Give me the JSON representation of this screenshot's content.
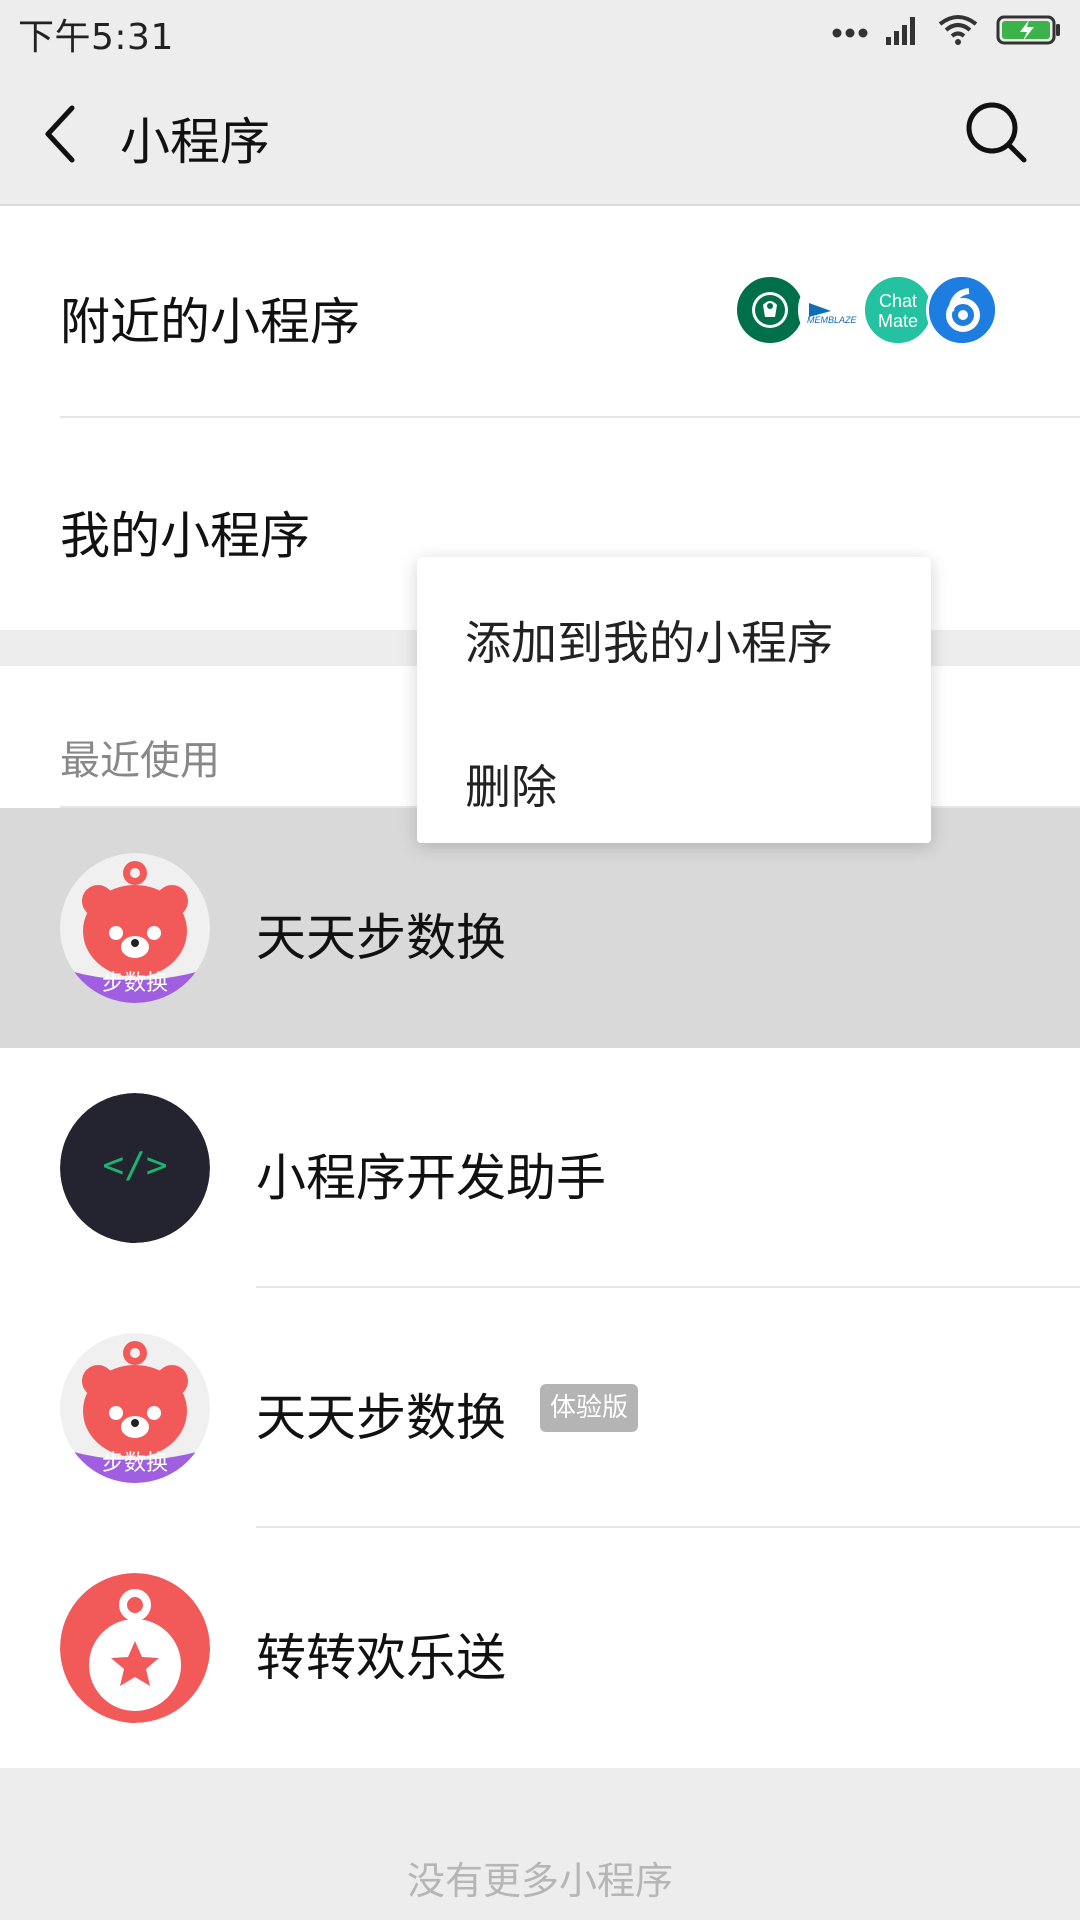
{
  "status_bar": {
    "time": "下午5:31",
    "icons": [
      "more-dots-icon",
      "signal-icon",
      "wifi-icon",
      "battery-charging-icon"
    ],
    "battery_color": "#3cb34a"
  },
  "header": {
    "title": "小程序",
    "back_icon": "chevron-left-icon",
    "search_icon": "search-icon"
  },
  "entries": {
    "nearby_label": "附近的小程序",
    "nearby_logos": [
      "starbucks-logo",
      "memblaze-logo",
      "chatmate-logo",
      "blue-six-logo"
    ],
    "nearby_logo_texts": {
      "memblaze": "MEMBLAZE",
      "chatmate": "Chat Mate"
    },
    "my_label": "我的小程序"
  },
  "recent": {
    "label": "最近使用",
    "items": [
      {
        "name": "天天步数换",
        "icon": "bear-step-icon",
        "icon_caption": "步数换",
        "badge": null,
        "pressed": true
      },
      {
        "name": "小程序开发助手",
        "icon": "code-icon",
        "icon_caption": "</>",
        "badge": null,
        "pressed": false
      },
      {
        "name": "天天步数换",
        "icon": "bear-step-icon",
        "icon_caption": "步数换",
        "badge": "体验版",
        "pressed": false
      },
      {
        "name": "转转欢乐送",
        "icon": "star-bag-icon",
        "icon_caption": "",
        "badge": null,
        "pressed": false
      }
    ],
    "footer": "没有更多小程序"
  },
  "context_menu": {
    "items": [
      "添加到我的小程序",
      "删除"
    ]
  },
  "colors": {
    "background": "#ededed",
    "pressed_row": "#d9d9d9",
    "bear_red": "#f25a5a",
    "bear_purple": "#a05fe0",
    "code_dark": "#23242f",
    "code_green": "#1db470",
    "star_red": "#f25a5a",
    "badge_gray": "#b4b4b4"
  }
}
